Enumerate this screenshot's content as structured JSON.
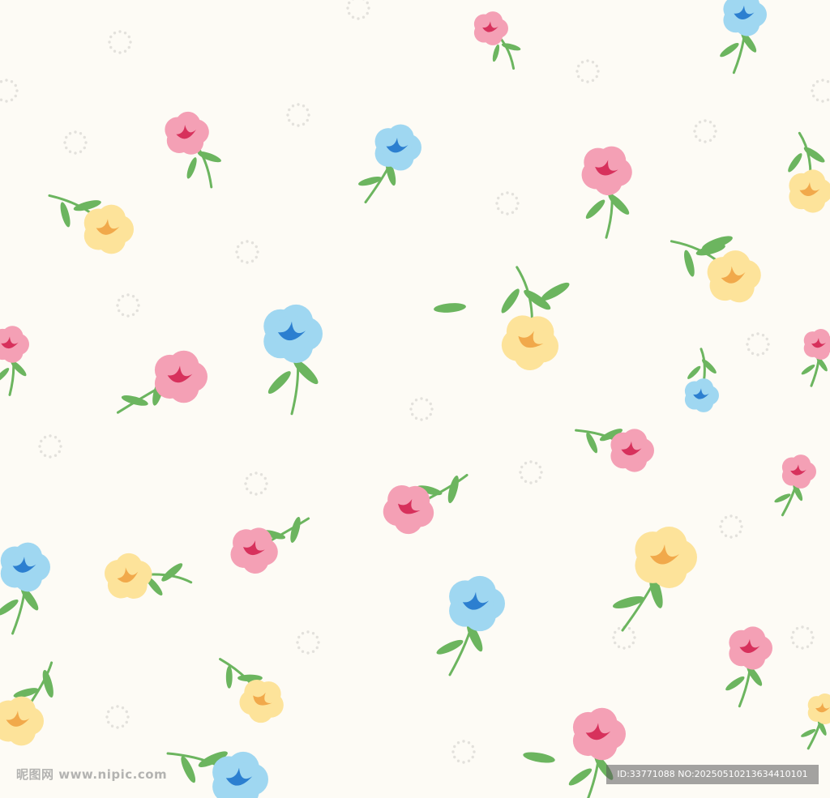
{
  "background_color": "#fdfbf5",
  "palette": {
    "pink": "#f4a0b5",
    "crimson": "#d7315c",
    "blue": "#9fd7f1",
    "deep_blue": "#2c7fd0",
    "yellow": "#fde39a",
    "orange": "#f1a94b",
    "leaf": "#6cb55f",
    "dot": "#e3e1dc"
  },
  "watermark": {
    "site": "昵图网 www.nipic.com",
    "id_text": "ID:33771088 NO:20250510213634410101"
  }
}
